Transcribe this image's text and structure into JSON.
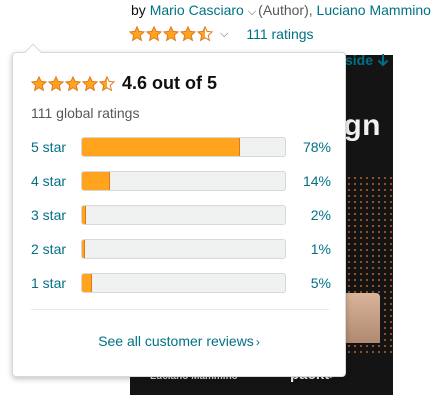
{
  "byline": {
    "prefix": "by",
    "author1": "Mario Casciaro",
    "role1": "(Author),",
    "author2": "Luciano Mammino"
  },
  "rating": {
    "stars_value": 4.5,
    "ratings_link": "111 ratings"
  },
  "look_inside": "side",
  "cover": {
    "title_fragment": "gn",
    "author_text": "Luciano Mammino",
    "brand_text": "packt>"
  },
  "popover": {
    "average_text": "4.6 out of 5",
    "stars_value": 4.5,
    "global_ratings": "111 global ratings",
    "histogram": [
      {
        "label": "5 star",
        "percent_text": "78%",
        "value": 78
      },
      {
        "label": "4 star",
        "percent_text": "14%",
        "value": 14
      },
      {
        "label": "3 star",
        "percent_text": "2%",
        "value": 2
      },
      {
        "label": "2 star",
        "percent_text": "1%",
        "value": 1
      },
      {
        "label": "1 star",
        "percent_text": "5%",
        "value": 5
      }
    ],
    "see_all": "See all customer reviews"
  },
  "colors": {
    "link": "#007185",
    "star_fill": "#ffa41c",
    "star_stroke": "#de7921",
    "text_secondary": "#565959"
  },
  "icons": {
    "star": "star-icon",
    "chevron": "chevron-down-icon",
    "caret": "chevron-right-icon",
    "look_inside_arrow": "arrow-down-icon"
  }
}
